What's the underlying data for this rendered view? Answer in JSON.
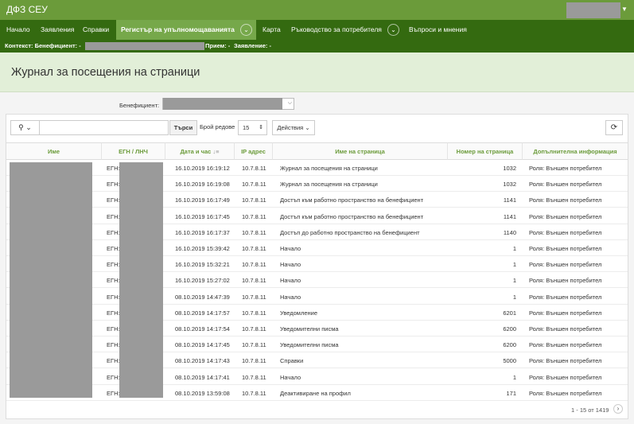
{
  "app": {
    "title": "ДФЗ СЕУ"
  },
  "nav": {
    "items": [
      "Начало",
      "Заявления",
      "Справки",
      "Регистър на упълномощаванията",
      "Карта",
      "Ръководство за потребителя",
      "Въпроси и мнения"
    ]
  },
  "context": {
    "label": "Контекст: Бенефициент: -",
    "priem": "Прием: -",
    "zayavlenie": "Заявление: -"
  },
  "page": {
    "title": "Журнал за посещения на страници"
  },
  "filter": {
    "label": "Бенефициент:"
  },
  "toolbar": {
    "search_button": "Търси",
    "rows_label": "Брой редове",
    "rows_value": "15",
    "actions_label": "Действия"
  },
  "table": {
    "headers": [
      "Име",
      "ЕГН / ЛНЧ",
      "Дата и час",
      "IP адрес",
      "Име на страница",
      "Номер на страница",
      "Допълнителна информация"
    ],
    "egn_prefix": "ЕГН:",
    "rows": [
      {
        "date": "16.10.2019 16:19:12",
        "ip": "10.7.8.11",
        "page": "Журнал за посещения на страници",
        "num": "1032",
        "info": "Роля: Външен потребител"
      },
      {
        "date": "16.10.2019 16:19:08",
        "ip": "10.7.8.11",
        "page": "Журнал за посещения на страници",
        "num": "1032",
        "info": "Роля: Външен потребител"
      },
      {
        "date": "16.10.2019 16:17:49",
        "ip": "10.7.8.11",
        "page": "Достъп към работно пространство на бенефициент",
        "num": "1141",
        "info": "Роля: Външен потребител"
      },
      {
        "date": "16.10.2019 16:17:45",
        "ip": "10.7.8.11",
        "page": "Достъп към работно пространство на бенефициент",
        "num": "1141",
        "info": "Роля: Външен потребител"
      },
      {
        "date": "16.10.2019 16:17:37",
        "ip": "10.7.8.11",
        "page": "Достъп до работно пространство на бенефициент",
        "num": "1140",
        "info": "Роля: Външен потребител"
      },
      {
        "date": "16.10.2019 15:39:42",
        "ip": "10.7.8.11",
        "page": "Начало",
        "num": "1",
        "info": "Роля: Външен потребител"
      },
      {
        "date": "16.10.2019 15:32:21",
        "ip": "10.7.8.11",
        "page": "Начало",
        "num": "1",
        "info": "Роля: Външен потребител"
      },
      {
        "date": "16.10.2019 15:27:02",
        "ip": "10.7.8.11",
        "page": "Начало",
        "num": "1",
        "info": "Роля: Външен потребител"
      },
      {
        "date": "08.10.2019 14:47:39",
        "ip": "10.7.8.11",
        "page": "Начало",
        "num": "1",
        "info": "Роля: Външен потребител"
      },
      {
        "date": "08.10.2019 14:17:57",
        "ip": "10.7.8.11",
        "page": "Уведомление",
        "num": "6201",
        "info": "Роля: Външен потребител"
      },
      {
        "date": "08.10.2019 14:17:54",
        "ip": "10.7.8.11",
        "page": "Уведомителни писма",
        "num": "6200",
        "info": "Роля: Външен потребител"
      },
      {
        "date": "08.10.2019 14:17:45",
        "ip": "10.7.8.11",
        "page": "Уведомителни писма",
        "num": "6200",
        "info": "Роля: Външен потребител"
      },
      {
        "date": "08.10.2019 14:17:43",
        "ip": "10.7.8.11",
        "page": "Справки",
        "num": "5000",
        "info": "Роля: Външен потребител"
      },
      {
        "date": "08.10.2019 14:17:41",
        "ip": "10.7.8.11",
        "page": "Начало",
        "num": "1",
        "info": "Роля: Външен потребител"
      },
      {
        "date": "08.10.2019 13:59:08",
        "ip": "10.7.8.11",
        "page": "Деактивиране на профил",
        "num": "171",
        "info": "Роля: Външен потребител"
      }
    ]
  },
  "pagination": {
    "text": "1 - 15 от 1419"
  }
}
